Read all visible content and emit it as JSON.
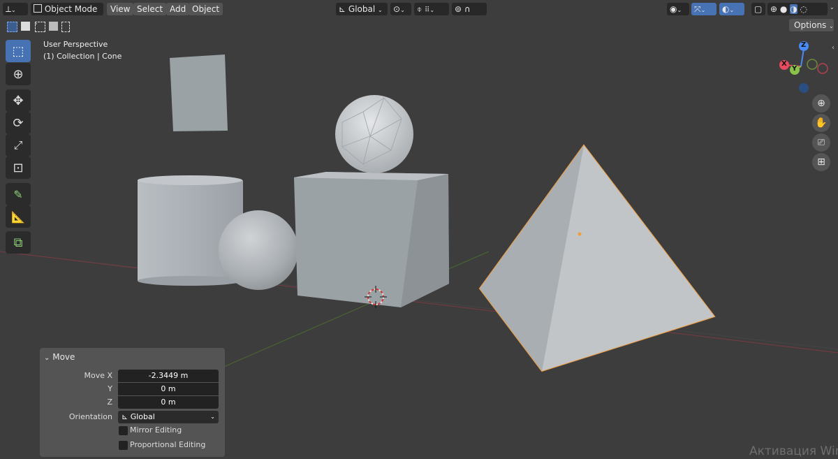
{
  "header": {
    "mode_label": "Object Mode",
    "menus": [
      "View",
      "Select",
      "Add",
      "Object"
    ],
    "orientation_label": "Global"
  },
  "subheader": {
    "options_label": "Options"
  },
  "overlay": {
    "view_name": "User Perspective",
    "collection": "(1) Collection | Cone"
  },
  "gizmo": {
    "x_label": "X",
    "y_label": "Y",
    "z_label": "Z"
  },
  "operator_panel": {
    "title": "Move",
    "move_x_label": "Move X",
    "move_x_value": "-2.3449 m",
    "y_label": "Y",
    "y_value": "0 m",
    "z_label": "Z",
    "z_value": "0 m",
    "orientation_label": "Orientation",
    "orientation_value": "Global",
    "mirror_label": "Mirror Editing",
    "proportional_label": "Proportional Editing"
  },
  "watermark": "Активация Win",
  "colors": {
    "viewport_bg": "#3d3d3d",
    "selection_outline": "#f29d3c",
    "active_tool": "#4772b3",
    "axis_x": "#e84a5f",
    "axis_y": "#8bc34a",
    "axis_z": "#4a8af4"
  }
}
